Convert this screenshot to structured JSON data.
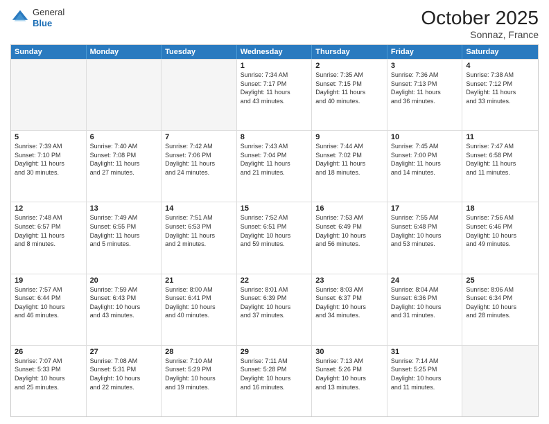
{
  "header": {
    "logo_line1": "General",
    "logo_line2": "Blue",
    "month": "October 2025",
    "location": "Sonnaz, France"
  },
  "days_of_week": [
    "Sunday",
    "Monday",
    "Tuesday",
    "Wednesday",
    "Thursday",
    "Friday",
    "Saturday"
  ],
  "weeks": [
    [
      {
        "day": "",
        "lines": []
      },
      {
        "day": "",
        "lines": []
      },
      {
        "day": "",
        "lines": []
      },
      {
        "day": "1",
        "lines": [
          "Sunrise: 7:34 AM",
          "Sunset: 7:17 PM",
          "Daylight: 11 hours",
          "and 43 minutes."
        ]
      },
      {
        "day": "2",
        "lines": [
          "Sunrise: 7:35 AM",
          "Sunset: 7:15 PM",
          "Daylight: 11 hours",
          "and 40 minutes."
        ]
      },
      {
        "day": "3",
        "lines": [
          "Sunrise: 7:36 AM",
          "Sunset: 7:13 PM",
          "Daylight: 11 hours",
          "and 36 minutes."
        ]
      },
      {
        "day": "4",
        "lines": [
          "Sunrise: 7:38 AM",
          "Sunset: 7:12 PM",
          "Daylight: 11 hours",
          "and 33 minutes."
        ]
      }
    ],
    [
      {
        "day": "5",
        "lines": [
          "Sunrise: 7:39 AM",
          "Sunset: 7:10 PM",
          "Daylight: 11 hours",
          "and 30 minutes."
        ]
      },
      {
        "day": "6",
        "lines": [
          "Sunrise: 7:40 AM",
          "Sunset: 7:08 PM",
          "Daylight: 11 hours",
          "and 27 minutes."
        ]
      },
      {
        "day": "7",
        "lines": [
          "Sunrise: 7:42 AM",
          "Sunset: 7:06 PM",
          "Daylight: 11 hours",
          "and 24 minutes."
        ]
      },
      {
        "day": "8",
        "lines": [
          "Sunrise: 7:43 AM",
          "Sunset: 7:04 PM",
          "Daylight: 11 hours",
          "and 21 minutes."
        ]
      },
      {
        "day": "9",
        "lines": [
          "Sunrise: 7:44 AM",
          "Sunset: 7:02 PM",
          "Daylight: 11 hours",
          "and 18 minutes."
        ]
      },
      {
        "day": "10",
        "lines": [
          "Sunrise: 7:45 AM",
          "Sunset: 7:00 PM",
          "Daylight: 11 hours",
          "and 14 minutes."
        ]
      },
      {
        "day": "11",
        "lines": [
          "Sunrise: 7:47 AM",
          "Sunset: 6:58 PM",
          "Daylight: 11 hours",
          "and 11 minutes."
        ]
      }
    ],
    [
      {
        "day": "12",
        "lines": [
          "Sunrise: 7:48 AM",
          "Sunset: 6:57 PM",
          "Daylight: 11 hours",
          "and 8 minutes."
        ]
      },
      {
        "day": "13",
        "lines": [
          "Sunrise: 7:49 AM",
          "Sunset: 6:55 PM",
          "Daylight: 11 hours",
          "and 5 minutes."
        ]
      },
      {
        "day": "14",
        "lines": [
          "Sunrise: 7:51 AM",
          "Sunset: 6:53 PM",
          "Daylight: 11 hours",
          "and 2 minutes."
        ]
      },
      {
        "day": "15",
        "lines": [
          "Sunrise: 7:52 AM",
          "Sunset: 6:51 PM",
          "Daylight: 10 hours",
          "and 59 minutes."
        ]
      },
      {
        "day": "16",
        "lines": [
          "Sunrise: 7:53 AM",
          "Sunset: 6:49 PM",
          "Daylight: 10 hours",
          "and 56 minutes."
        ]
      },
      {
        "day": "17",
        "lines": [
          "Sunrise: 7:55 AM",
          "Sunset: 6:48 PM",
          "Daylight: 10 hours",
          "and 53 minutes."
        ]
      },
      {
        "day": "18",
        "lines": [
          "Sunrise: 7:56 AM",
          "Sunset: 6:46 PM",
          "Daylight: 10 hours",
          "and 49 minutes."
        ]
      }
    ],
    [
      {
        "day": "19",
        "lines": [
          "Sunrise: 7:57 AM",
          "Sunset: 6:44 PM",
          "Daylight: 10 hours",
          "and 46 minutes."
        ]
      },
      {
        "day": "20",
        "lines": [
          "Sunrise: 7:59 AM",
          "Sunset: 6:43 PM",
          "Daylight: 10 hours",
          "and 43 minutes."
        ]
      },
      {
        "day": "21",
        "lines": [
          "Sunrise: 8:00 AM",
          "Sunset: 6:41 PM",
          "Daylight: 10 hours",
          "and 40 minutes."
        ]
      },
      {
        "day": "22",
        "lines": [
          "Sunrise: 8:01 AM",
          "Sunset: 6:39 PM",
          "Daylight: 10 hours",
          "and 37 minutes."
        ]
      },
      {
        "day": "23",
        "lines": [
          "Sunrise: 8:03 AM",
          "Sunset: 6:37 PM",
          "Daylight: 10 hours",
          "and 34 minutes."
        ]
      },
      {
        "day": "24",
        "lines": [
          "Sunrise: 8:04 AM",
          "Sunset: 6:36 PM",
          "Daylight: 10 hours",
          "and 31 minutes."
        ]
      },
      {
        "day": "25",
        "lines": [
          "Sunrise: 8:06 AM",
          "Sunset: 6:34 PM",
          "Daylight: 10 hours",
          "and 28 minutes."
        ]
      }
    ],
    [
      {
        "day": "26",
        "lines": [
          "Sunrise: 7:07 AM",
          "Sunset: 5:33 PM",
          "Daylight: 10 hours",
          "and 25 minutes."
        ]
      },
      {
        "day": "27",
        "lines": [
          "Sunrise: 7:08 AM",
          "Sunset: 5:31 PM",
          "Daylight: 10 hours",
          "and 22 minutes."
        ]
      },
      {
        "day": "28",
        "lines": [
          "Sunrise: 7:10 AM",
          "Sunset: 5:29 PM",
          "Daylight: 10 hours",
          "and 19 minutes."
        ]
      },
      {
        "day": "29",
        "lines": [
          "Sunrise: 7:11 AM",
          "Sunset: 5:28 PM",
          "Daylight: 10 hours",
          "and 16 minutes."
        ]
      },
      {
        "day": "30",
        "lines": [
          "Sunrise: 7:13 AM",
          "Sunset: 5:26 PM",
          "Daylight: 10 hours",
          "and 13 minutes."
        ]
      },
      {
        "day": "31",
        "lines": [
          "Sunrise: 7:14 AM",
          "Sunset: 5:25 PM",
          "Daylight: 10 hours",
          "and 11 minutes."
        ]
      },
      {
        "day": "",
        "lines": []
      }
    ]
  ]
}
